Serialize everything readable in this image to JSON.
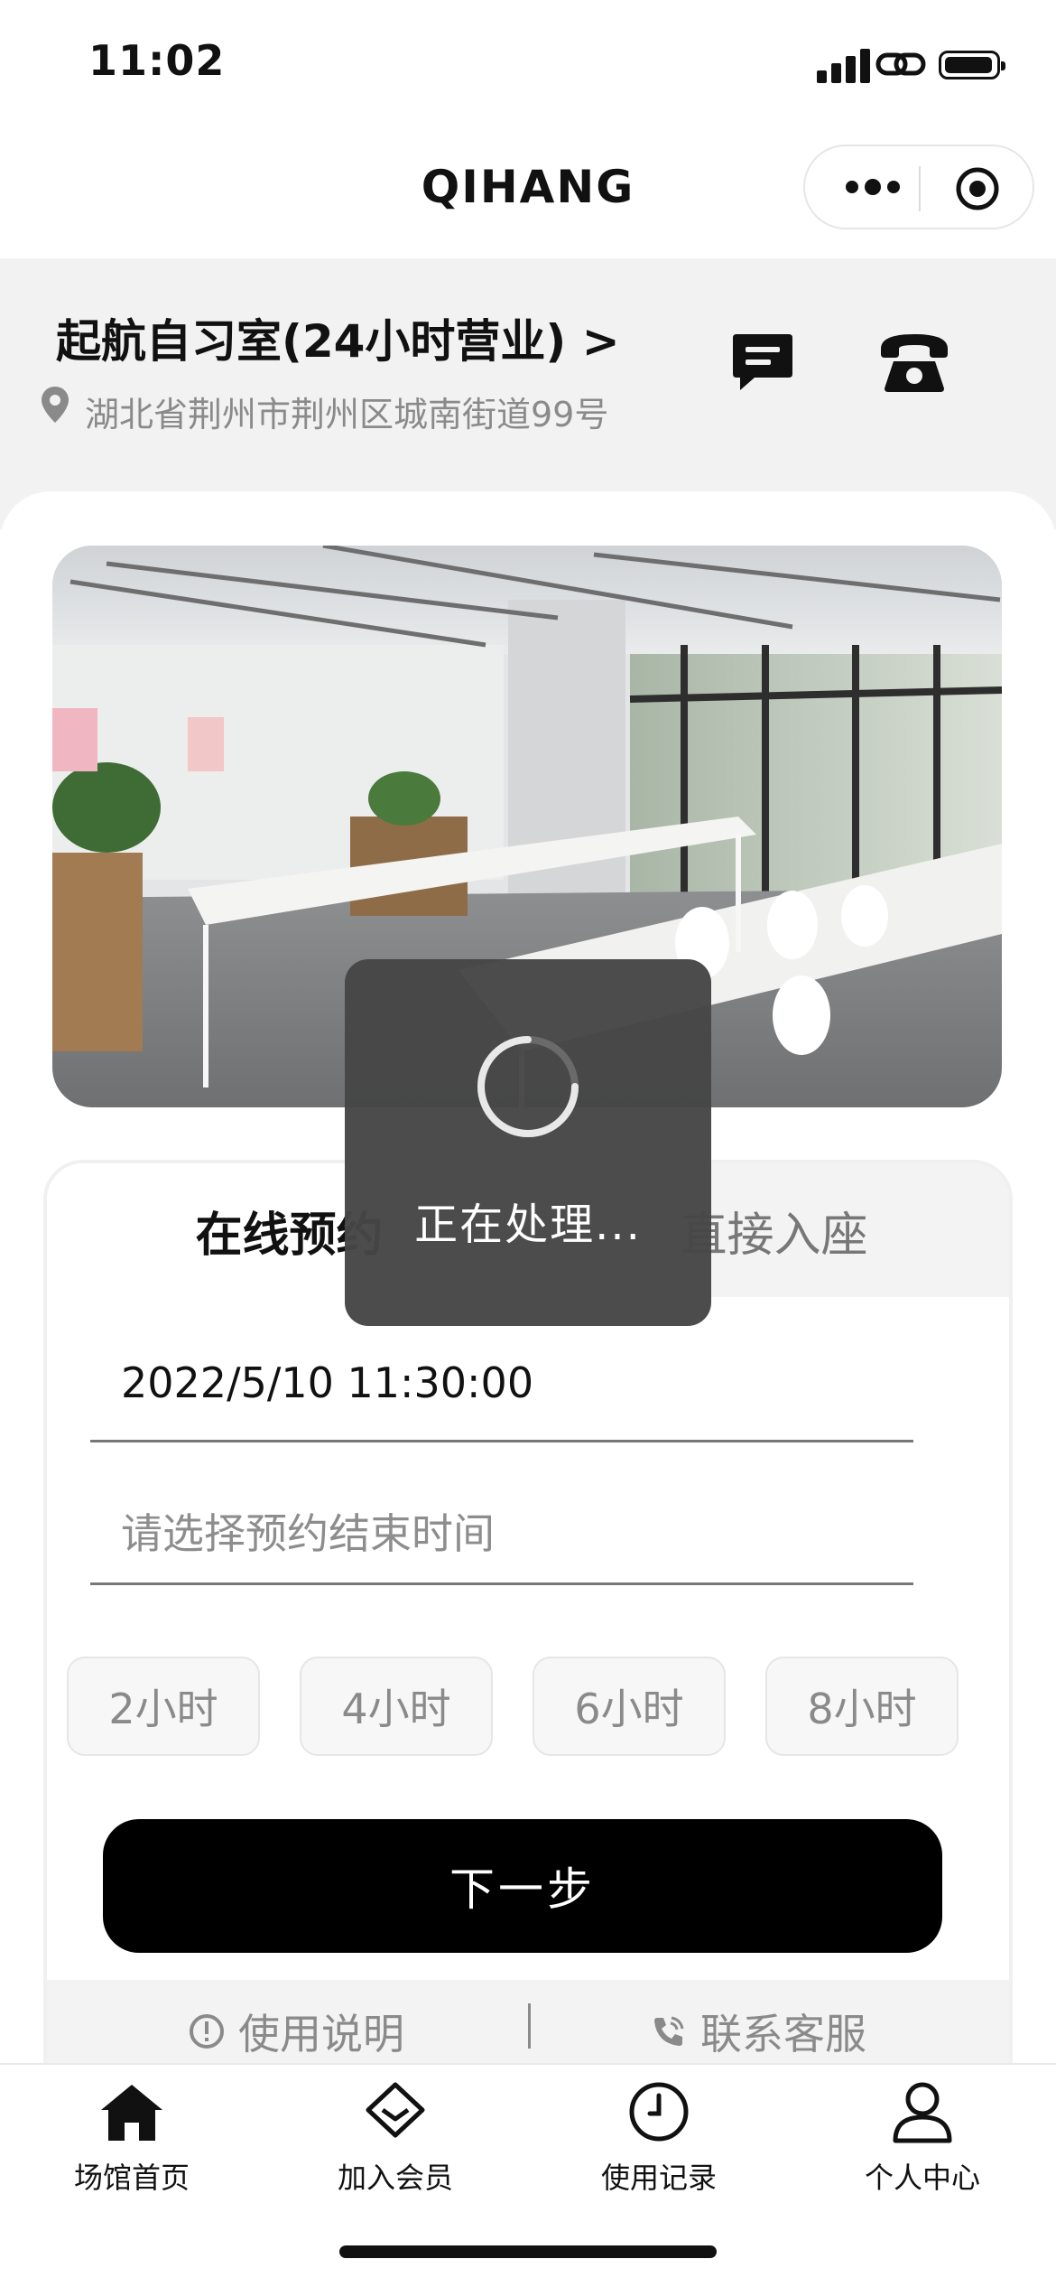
{
  "status_bar": {
    "time": "11:02"
  },
  "nav": {
    "title": "QIHANG"
  },
  "venue": {
    "name": "起航自习室(24小时营业) >",
    "address": "湖北省荆州市荆州区城南街道99号"
  },
  "booking": {
    "tabs": [
      {
        "label": "在线预约"
      },
      {
        "label": "直接入座"
      }
    ],
    "start_time": "2022/5/10 11:30:00",
    "end_time_placeholder": "请选择预约结束时间",
    "durations": [
      "2小时",
      "4小时",
      "6小时",
      "8小时"
    ],
    "next_label": "下一步"
  },
  "links": {
    "usage": "使用说明",
    "contact": "联系客服"
  },
  "tab_bar": {
    "items": [
      {
        "label": "场馆首页",
        "icon": "home-icon"
      },
      {
        "label": "加入会员",
        "icon": "diamond-icon"
      },
      {
        "label": "使用记录",
        "icon": "clock-icon"
      },
      {
        "label": "个人中心",
        "icon": "user-icon"
      }
    ]
  },
  "toast": {
    "text": "正在处理..."
  },
  "colors": {
    "primary": "#000000",
    "muted": "#8a8a8a",
    "background": "#f2f2f2",
    "toast": "#464646"
  }
}
